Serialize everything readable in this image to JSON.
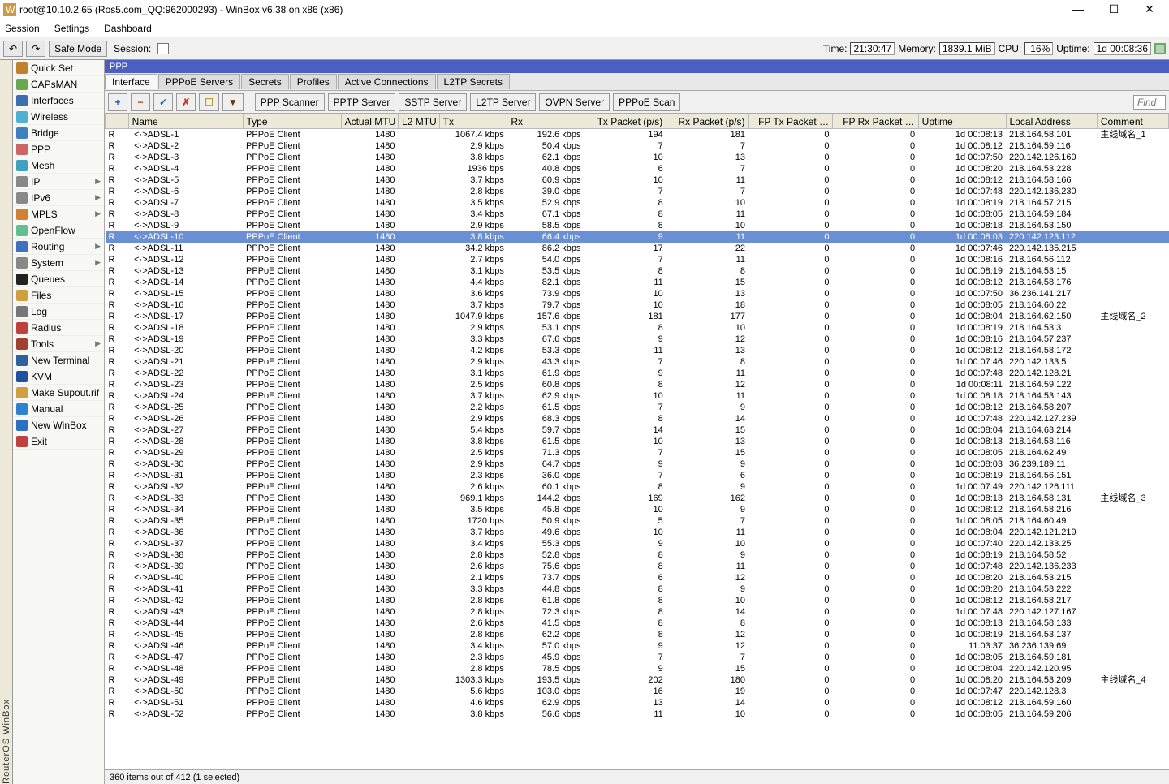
{
  "title": "root@10.10.2.65 (Ros5.com_QQ:962000293) - WinBox v6.38 on x86 (x86)",
  "menu": [
    "Session",
    "Settings",
    "Dashboard"
  ],
  "toolbar": {
    "back": "↶",
    "fwd": "↷",
    "safe_mode": "Safe Mode",
    "session_lbl": "Session:",
    "time_l": "Time:",
    "time_v": "21:30:47",
    "mem_l": "Memory:",
    "mem_v": "1839.1 MiB",
    "cpu_l": "CPU:",
    "cpu_v": "16%",
    "up_l": "Uptime:",
    "up_v": "1d 00:08:36"
  },
  "side_vert": "RouterOS WinBox",
  "nav": [
    {
      "label": "Quick Set",
      "ico": "#c08030"
    },
    {
      "label": "CAPsMAN",
      "ico": "#6aa84f"
    },
    {
      "label": "Interfaces",
      "ico": "#3b6fb0"
    },
    {
      "label": "Wireless",
      "ico": "#4fb0d0"
    },
    {
      "label": "Bridge",
      "ico": "#4080c0"
    },
    {
      "label": "PPP",
      "ico": "#cc6666"
    },
    {
      "label": "Mesh",
      "ico": "#40a0c0"
    },
    {
      "label": "IP",
      "ico": "#888",
      "arrow": true
    },
    {
      "label": "IPv6",
      "ico": "#888",
      "arrow": true
    },
    {
      "label": "MPLS",
      "ico": "#d08030",
      "arrow": true
    },
    {
      "label": "OpenFlow",
      "ico": "#60c090"
    },
    {
      "label": "Routing",
      "ico": "#4070c0",
      "arrow": true
    },
    {
      "label": "System",
      "ico": "#888",
      "arrow": true
    },
    {
      "label": "Queues",
      "ico": "#222"
    },
    {
      "label": "Files",
      "ico": "#d0a040"
    },
    {
      "label": "Log",
      "ico": "#777"
    },
    {
      "label": "Radius",
      "ico": "#c04040"
    },
    {
      "label": "Tools",
      "ico": "#a04030",
      "arrow": true
    },
    {
      "label": "New Terminal",
      "ico": "#3060a0"
    },
    {
      "label": "KVM",
      "ico": "#2050a0"
    },
    {
      "label": "Make Supout.rif",
      "ico": "#d0a040"
    },
    {
      "label": "Manual",
      "ico": "#3080d0"
    },
    {
      "label": "New WinBox",
      "ico": "#3070c0"
    },
    {
      "label": "Exit",
      "ico": "#c04040"
    }
  ],
  "panel_title": "PPP",
  "tabs": [
    "Interface",
    "PPPoE Servers",
    "Secrets",
    "Profiles",
    "Active Connections",
    "L2TP Secrets"
  ],
  "active_tab": "Interface",
  "actions_icons": [
    "+",
    "−",
    "✓",
    "✗",
    "☐",
    "▼"
  ],
  "actions_btns": [
    "PPP Scanner",
    "PPTP Server",
    "SSTP Server",
    "L2TP Server",
    "OVPN Server",
    "PPPoE Scan"
  ],
  "find": "Find",
  "columns": [
    "",
    "Name",
    "Type",
    "Actual MTU",
    "L2 MTU",
    "Tx",
    "Rx",
    "Tx Packet (p/s)",
    "Rx Packet (p/s)",
    "FP Tx Packet …",
    "FP Rx Packet …",
    "Uptime",
    "Local Address",
    "Comment"
  ],
  "rows": [
    {
      "f": "R",
      "n": "ADSL-1",
      "t": "PPPoE Client",
      "mtu": 1480,
      "tx": "1067.4 kbps",
      "rx": "192.6 kbps",
      "txp": 194,
      "rxp": 181,
      "fptx": 0,
      "fprx": 0,
      "up": "1d 00:08:13",
      "la": "218.164.58.101",
      "cm": "主线域名_1"
    },
    {
      "f": "R",
      "n": "ADSL-2",
      "t": "PPPoE Client",
      "mtu": 1480,
      "tx": "2.9 kbps",
      "rx": "50.4 kbps",
      "txp": 7,
      "rxp": 7,
      "fptx": 0,
      "fprx": 0,
      "up": "1d 00:08:12",
      "la": "218.164.59.116",
      "cm": ""
    },
    {
      "f": "R",
      "n": "ADSL-3",
      "t": "PPPoE Client",
      "mtu": 1480,
      "tx": "3.8 kbps",
      "rx": "62.1 kbps",
      "txp": 10,
      "rxp": 13,
      "fptx": 0,
      "fprx": 0,
      "up": "1d 00:07:50",
      "la": "220.142.126.160",
      "cm": ""
    },
    {
      "f": "R",
      "n": "ADSL-4",
      "t": "PPPoE Client",
      "mtu": 1480,
      "tx": "1936 bps",
      "rx": "40.8 kbps",
      "txp": 6,
      "rxp": 7,
      "fptx": 0,
      "fprx": 0,
      "up": "1d 00:08:20",
      "la": "218.164.53.228",
      "cm": ""
    },
    {
      "f": "R",
      "n": "ADSL-5",
      "t": "PPPoE Client",
      "mtu": 1480,
      "tx": "3.7 kbps",
      "rx": "60.9 kbps",
      "txp": 10,
      "rxp": 11,
      "fptx": 0,
      "fprx": 0,
      "up": "1d 00:08:12",
      "la": "218.164.58.166",
      "cm": ""
    },
    {
      "f": "R",
      "n": "ADSL-6",
      "t": "PPPoE Client",
      "mtu": 1480,
      "tx": "2.8 kbps",
      "rx": "39.0 kbps",
      "txp": 7,
      "rxp": 7,
      "fptx": 0,
      "fprx": 0,
      "up": "1d 00:07:48",
      "la": "220.142.136.230",
      "cm": ""
    },
    {
      "f": "R",
      "n": "ADSL-7",
      "t": "PPPoE Client",
      "mtu": 1480,
      "tx": "3.5 kbps",
      "rx": "52.9 kbps",
      "txp": 8,
      "rxp": 10,
      "fptx": 0,
      "fprx": 0,
      "up": "1d 00:08:19",
      "la": "218.164.57.215",
      "cm": ""
    },
    {
      "f": "R",
      "n": "ADSL-8",
      "t": "PPPoE Client",
      "mtu": 1480,
      "tx": "3.4 kbps",
      "rx": "67.1 kbps",
      "txp": 8,
      "rxp": 11,
      "fptx": 0,
      "fprx": 0,
      "up": "1d 00:08:05",
      "la": "218.164.59.184",
      "cm": ""
    },
    {
      "f": "R",
      "n": "ADSL-9",
      "t": "PPPoE Client",
      "mtu": 1480,
      "tx": "2.9 kbps",
      "rx": "58.5 kbps",
      "txp": 8,
      "rxp": 10,
      "fptx": 0,
      "fprx": 0,
      "up": "1d 00:08:18",
      "la": "218.164.53.150",
      "cm": ""
    },
    {
      "f": "R",
      "n": "ADSL-10",
      "t": "PPPoE Client",
      "mtu": 1480,
      "tx": "3.8 kbps",
      "rx": "66.4 kbps",
      "txp": 9,
      "rxp": 11,
      "fptx": 0,
      "fprx": 0,
      "up": "1d 00:08:03",
      "la": "220.142.123.112",
      "cm": "",
      "sel": true
    },
    {
      "f": "R",
      "n": "ADSL-11",
      "t": "PPPoE Client",
      "mtu": 1480,
      "tx": "34.2 kbps",
      "rx": "86.2 kbps",
      "txp": 17,
      "rxp": 22,
      "fptx": 0,
      "fprx": 0,
      "up": "1d 00:07:46",
      "la": "220.142.135.215",
      "cm": ""
    },
    {
      "f": "R",
      "n": "ADSL-12",
      "t": "PPPoE Client",
      "mtu": 1480,
      "tx": "2.7 kbps",
      "rx": "54.0 kbps",
      "txp": 7,
      "rxp": 11,
      "fptx": 0,
      "fprx": 0,
      "up": "1d 00:08:16",
      "la": "218.164.56.112",
      "cm": ""
    },
    {
      "f": "R",
      "n": "ADSL-13",
      "t": "PPPoE Client",
      "mtu": 1480,
      "tx": "3.1 kbps",
      "rx": "53.5 kbps",
      "txp": 8,
      "rxp": 8,
      "fptx": 0,
      "fprx": 0,
      "up": "1d 00:08:19",
      "la": "218.164.53.15",
      "cm": ""
    },
    {
      "f": "R",
      "n": "ADSL-14",
      "t": "PPPoE Client",
      "mtu": 1480,
      "tx": "4.4 kbps",
      "rx": "82.1 kbps",
      "txp": 11,
      "rxp": 15,
      "fptx": 0,
      "fprx": 0,
      "up": "1d 00:08:12",
      "la": "218.164.58.176",
      "cm": ""
    },
    {
      "f": "R",
      "n": "ADSL-15",
      "t": "PPPoE Client",
      "mtu": 1480,
      "tx": "3.6 kbps",
      "rx": "73.9 kbps",
      "txp": 10,
      "rxp": 13,
      "fptx": 0,
      "fprx": 0,
      "up": "1d 00:07:50",
      "la": "36.236.141.217",
      "cm": ""
    },
    {
      "f": "R",
      "n": "ADSL-16",
      "t": "PPPoE Client",
      "mtu": 1480,
      "tx": "3.7 kbps",
      "rx": "79.7 kbps",
      "txp": 10,
      "rxp": 18,
      "fptx": 0,
      "fprx": 0,
      "up": "1d 00:08:05",
      "la": "218.164.60.22",
      "cm": ""
    },
    {
      "f": "R",
      "n": "ADSL-17",
      "t": "PPPoE Client",
      "mtu": 1480,
      "tx": "1047.9 kbps",
      "rx": "157.6 kbps",
      "txp": 181,
      "rxp": 177,
      "fptx": 0,
      "fprx": 0,
      "up": "1d 00:08:04",
      "la": "218.164.62.150",
      "cm": "主线域名_2"
    },
    {
      "f": "R",
      "n": "ADSL-18",
      "t": "PPPoE Client",
      "mtu": 1480,
      "tx": "2.9 kbps",
      "rx": "53.1 kbps",
      "txp": 8,
      "rxp": 10,
      "fptx": 0,
      "fprx": 0,
      "up": "1d 00:08:19",
      "la": "218.164.53.3",
      "cm": ""
    },
    {
      "f": "R",
      "n": "ADSL-19",
      "t": "PPPoE Client",
      "mtu": 1480,
      "tx": "3.3 kbps",
      "rx": "67.6 kbps",
      "txp": 9,
      "rxp": 12,
      "fptx": 0,
      "fprx": 0,
      "up": "1d 00:08:16",
      "la": "218.164.57.237",
      "cm": ""
    },
    {
      "f": "R",
      "n": "ADSL-20",
      "t": "PPPoE Client",
      "mtu": 1480,
      "tx": "4.2 kbps",
      "rx": "53.3 kbps",
      "txp": 11,
      "rxp": 13,
      "fptx": 0,
      "fprx": 0,
      "up": "1d 00:08:12",
      "la": "218.164.58.172",
      "cm": ""
    },
    {
      "f": "R",
      "n": "ADSL-21",
      "t": "PPPoE Client",
      "mtu": 1480,
      "tx": "2.9 kbps",
      "rx": "43.3 kbps",
      "txp": 7,
      "rxp": 8,
      "fptx": 0,
      "fprx": 0,
      "up": "1d 00:07:46",
      "la": "220.142.133.5",
      "cm": ""
    },
    {
      "f": "R",
      "n": "ADSL-22",
      "t": "PPPoE Client",
      "mtu": 1480,
      "tx": "3.1 kbps",
      "rx": "61.9 kbps",
      "txp": 9,
      "rxp": 11,
      "fptx": 0,
      "fprx": 0,
      "up": "1d 00:07:48",
      "la": "220.142.128.21",
      "cm": ""
    },
    {
      "f": "R",
      "n": "ADSL-23",
      "t": "PPPoE Client",
      "mtu": 1480,
      "tx": "2.5 kbps",
      "rx": "60.8 kbps",
      "txp": 8,
      "rxp": 12,
      "fptx": 0,
      "fprx": 0,
      "up": "1d 00:08:11",
      "la": "218.164.59.122",
      "cm": ""
    },
    {
      "f": "R",
      "n": "ADSL-24",
      "t": "PPPoE Client",
      "mtu": 1480,
      "tx": "3.7 kbps",
      "rx": "62.9 kbps",
      "txp": 10,
      "rxp": 11,
      "fptx": 0,
      "fprx": 0,
      "up": "1d 00:08:18",
      "la": "218.164.53.143",
      "cm": ""
    },
    {
      "f": "R",
      "n": "ADSL-25",
      "t": "PPPoE Client",
      "mtu": 1480,
      "tx": "2.2 kbps",
      "rx": "61.5 kbps",
      "txp": 7,
      "rxp": 9,
      "fptx": 0,
      "fprx": 0,
      "up": "1d 00:08:12",
      "la": "218.164.58.207",
      "cm": ""
    },
    {
      "f": "R",
      "n": "ADSL-26",
      "t": "PPPoE Client",
      "mtu": 1480,
      "tx": "2.9 kbps",
      "rx": "68.3 kbps",
      "txp": 8,
      "rxp": 14,
      "fptx": 0,
      "fprx": 0,
      "up": "1d 00:07:48",
      "la": "220.142.127.239",
      "cm": ""
    },
    {
      "f": "R",
      "n": "ADSL-27",
      "t": "PPPoE Client",
      "mtu": 1480,
      "tx": "5.4 kbps",
      "rx": "59.7 kbps",
      "txp": 14,
      "rxp": 15,
      "fptx": 0,
      "fprx": 0,
      "up": "1d 00:08:04",
      "la": "218.164.63.214",
      "cm": ""
    },
    {
      "f": "R",
      "n": "ADSL-28",
      "t": "PPPoE Client",
      "mtu": 1480,
      "tx": "3.8 kbps",
      "rx": "61.5 kbps",
      "txp": 10,
      "rxp": 13,
      "fptx": 0,
      "fprx": 0,
      "up": "1d 00:08:13",
      "la": "218.164.58.116",
      "cm": ""
    },
    {
      "f": "R",
      "n": "ADSL-29",
      "t": "PPPoE Client",
      "mtu": 1480,
      "tx": "2.5 kbps",
      "rx": "71.3 kbps",
      "txp": 7,
      "rxp": 15,
      "fptx": 0,
      "fprx": 0,
      "up": "1d 00:08:05",
      "la": "218.164.62.49",
      "cm": ""
    },
    {
      "f": "R",
      "n": "ADSL-30",
      "t": "PPPoE Client",
      "mtu": 1480,
      "tx": "2.9 kbps",
      "rx": "64.7 kbps",
      "txp": 9,
      "rxp": 9,
      "fptx": 0,
      "fprx": 0,
      "up": "1d 00:08:03",
      "la": "36.239.189.11",
      "cm": ""
    },
    {
      "f": "R",
      "n": "ADSL-31",
      "t": "PPPoE Client",
      "mtu": 1480,
      "tx": "2.3 kbps",
      "rx": "36.0 kbps",
      "txp": 7,
      "rxp": 6,
      "fptx": 0,
      "fprx": 0,
      "up": "1d 00:08:19",
      "la": "218.164.56.151",
      "cm": ""
    },
    {
      "f": "R",
      "n": "ADSL-32",
      "t": "PPPoE Client",
      "mtu": 1480,
      "tx": "2.6 kbps",
      "rx": "60.1 kbps",
      "txp": 8,
      "rxp": 9,
      "fptx": 0,
      "fprx": 0,
      "up": "1d 00:07:49",
      "la": "220.142.126.111",
      "cm": ""
    },
    {
      "f": "R",
      "n": "ADSL-33",
      "t": "PPPoE Client",
      "mtu": 1480,
      "tx": "969.1 kbps",
      "rx": "144.2 kbps",
      "txp": 169,
      "rxp": 162,
      "fptx": 0,
      "fprx": 0,
      "up": "1d 00:08:13",
      "la": "218.164.58.131",
      "cm": "主线域名_3"
    },
    {
      "f": "R",
      "n": "ADSL-34",
      "t": "PPPoE Client",
      "mtu": 1480,
      "tx": "3.5 kbps",
      "rx": "45.8 kbps",
      "txp": 10,
      "rxp": 9,
      "fptx": 0,
      "fprx": 0,
      "up": "1d 00:08:12",
      "la": "218.164.58.216",
      "cm": ""
    },
    {
      "f": "R",
      "n": "ADSL-35",
      "t": "PPPoE Client",
      "mtu": 1480,
      "tx": "1720 bps",
      "rx": "50.9 kbps",
      "txp": 5,
      "rxp": 7,
      "fptx": 0,
      "fprx": 0,
      "up": "1d 00:08:05",
      "la": "218.164.60.49",
      "cm": ""
    },
    {
      "f": "R",
      "n": "ADSL-36",
      "t": "PPPoE Client",
      "mtu": 1480,
      "tx": "3.7 kbps",
      "rx": "49.6 kbps",
      "txp": 10,
      "rxp": 11,
      "fptx": 0,
      "fprx": 0,
      "up": "1d 00:08:04",
      "la": "220.142.121.219",
      "cm": ""
    },
    {
      "f": "R",
      "n": "ADSL-37",
      "t": "PPPoE Client",
      "mtu": 1480,
      "tx": "3.4 kbps",
      "rx": "55.3 kbps",
      "txp": 9,
      "rxp": 10,
      "fptx": 0,
      "fprx": 0,
      "up": "1d 00:07:40",
      "la": "220.142.133.25",
      "cm": ""
    },
    {
      "f": "R",
      "n": "ADSL-38",
      "t": "PPPoE Client",
      "mtu": 1480,
      "tx": "2.8 kbps",
      "rx": "52.8 kbps",
      "txp": 8,
      "rxp": 9,
      "fptx": 0,
      "fprx": 0,
      "up": "1d 00:08:19",
      "la": "218.164.58.52",
      "cm": ""
    },
    {
      "f": "R",
      "n": "ADSL-39",
      "t": "PPPoE Client",
      "mtu": 1480,
      "tx": "2.6 kbps",
      "rx": "75.6 kbps",
      "txp": 8,
      "rxp": 11,
      "fptx": 0,
      "fprx": 0,
      "up": "1d 00:07:48",
      "la": "220.142.136.233",
      "cm": ""
    },
    {
      "f": "R",
      "n": "ADSL-40",
      "t": "PPPoE Client",
      "mtu": 1480,
      "tx": "2.1 kbps",
      "rx": "73.7 kbps",
      "txp": 6,
      "rxp": 12,
      "fptx": 0,
      "fprx": 0,
      "up": "1d 00:08:20",
      "la": "218.164.53.215",
      "cm": ""
    },
    {
      "f": "R",
      "n": "ADSL-41",
      "t": "PPPoE Client",
      "mtu": 1480,
      "tx": "3.3 kbps",
      "rx": "44.8 kbps",
      "txp": 8,
      "rxp": 9,
      "fptx": 0,
      "fprx": 0,
      "up": "1d 00:08:20",
      "la": "218.164.53.222",
      "cm": ""
    },
    {
      "f": "R",
      "n": "ADSL-42",
      "t": "PPPoE Client",
      "mtu": 1480,
      "tx": "2.8 kbps",
      "rx": "61.8 kbps",
      "txp": 8,
      "rxp": 10,
      "fptx": 0,
      "fprx": 0,
      "up": "1d 00:08:12",
      "la": "218.164.58.217",
      "cm": ""
    },
    {
      "f": "R",
      "n": "ADSL-43",
      "t": "PPPoE Client",
      "mtu": 1480,
      "tx": "2.8 kbps",
      "rx": "72.3 kbps",
      "txp": 8,
      "rxp": 14,
      "fptx": 0,
      "fprx": 0,
      "up": "1d 00:07:48",
      "la": "220.142.127.167",
      "cm": ""
    },
    {
      "f": "R",
      "n": "ADSL-44",
      "t": "PPPoE Client",
      "mtu": 1480,
      "tx": "2.6 kbps",
      "rx": "41.5 kbps",
      "txp": 8,
      "rxp": 8,
      "fptx": 0,
      "fprx": 0,
      "up": "1d 00:08:13",
      "la": "218.164.58.133",
      "cm": ""
    },
    {
      "f": "R",
      "n": "ADSL-45",
      "t": "PPPoE Client",
      "mtu": 1480,
      "tx": "2.8 kbps",
      "rx": "62.2 kbps",
      "txp": 8,
      "rxp": 12,
      "fptx": 0,
      "fprx": 0,
      "up": "1d 00:08:19",
      "la": "218.164.53.137",
      "cm": ""
    },
    {
      "f": "R",
      "n": "ADSL-46",
      "t": "PPPoE Client",
      "mtu": 1480,
      "tx": "3.4 kbps",
      "rx": "57.0 kbps",
      "txp": 9,
      "rxp": 12,
      "fptx": 0,
      "fprx": 0,
      "up": "11:03:37",
      "la": "36.236.139.69",
      "cm": ""
    },
    {
      "f": "R",
      "n": "ADSL-47",
      "t": "PPPoE Client",
      "mtu": 1480,
      "tx": "2.3 kbps",
      "rx": "45.9 kbps",
      "txp": 7,
      "rxp": 7,
      "fptx": 0,
      "fprx": 0,
      "up": "1d 00:08:05",
      "la": "218.164.59.181",
      "cm": ""
    },
    {
      "f": "R",
      "n": "ADSL-48",
      "t": "PPPoE Client",
      "mtu": 1480,
      "tx": "2.8 kbps",
      "rx": "78.5 kbps",
      "txp": 9,
      "rxp": 15,
      "fptx": 0,
      "fprx": 0,
      "up": "1d 00:08:04",
      "la": "220.142.120.95",
      "cm": ""
    },
    {
      "f": "R",
      "n": "ADSL-49",
      "t": "PPPoE Client",
      "mtu": 1480,
      "tx": "1303.3 kbps",
      "rx": "193.5 kbps",
      "txp": 202,
      "rxp": 180,
      "fptx": 0,
      "fprx": 0,
      "up": "1d 00:08:20",
      "la": "218.164.53.209",
      "cm": "主线域名_4"
    },
    {
      "f": "R",
      "n": "ADSL-50",
      "t": "PPPoE Client",
      "mtu": 1480,
      "tx": "5.6 kbps",
      "rx": "103.0 kbps",
      "txp": 16,
      "rxp": 19,
      "fptx": 0,
      "fprx": 0,
      "up": "1d 00:07:47",
      "la": "220.142.128.3",
      "cm": ""
    },
    {
      "f": "R",
      "n": "ADSL-51",
      "t": "PPPoE Client",
      "mtu": 1480,
      "tx": "4.6 kbps",
      "rx": "62.9 kbps",
      "txp": 13,
      "rxp": 14,
      "fptx": 0,
      "fprx": 0,
      "up": "1d 00:08:12",
      "la": "218.164.59.160",
      "cm": ""
    },
    {
      "f": "R",
      "n": "ADSL-52",
      "t": "PPPoE Client",
      "mtu": 1480,
      "tx": "3.8 kbps",
      "rx": "56.6 kbps",
      "txp": 11,
      "rxp": 10,
      "fptx": 0,
      "fprx": 0,
      "up": "1d 00:08:05",
      "la": "218.164.59.206",
      "cm": ""
    }
  ],
  "status": "360 items out of 412 (1 selected)"
}
